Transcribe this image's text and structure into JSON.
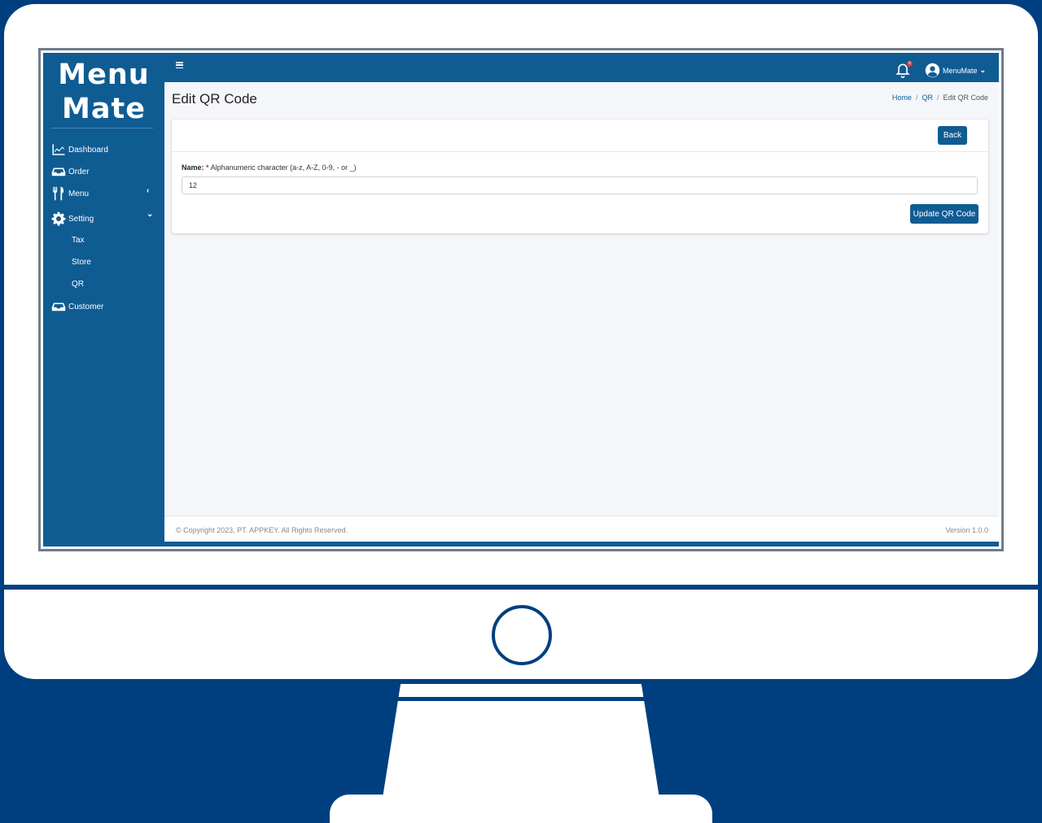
{
  "brand": {
    "line1": "Menu",
    "line2": "Mate"
  },
  "sidebar": {
    "items": [
      {
        "label": "Dashboard",
        "icon": "chart-line-icon"
      },
      {
        "label": "Order",
        "icon": "tray-icon"
      },
      {
        "label": "Menu",
        "icon": "utensils-icon",
        "chevron": "‹"
      },
      {
        "label": "Setting",
        "icon": "gear-icon",
        "chevron": "⌄"
      },
      {
        "label": "Customer",
        "icon": "tray-icon"
      }
    ],
    "sub_items": [
      "Tax",
      "Store",
      "QR"
    ]
  },
  "topbar": {
    "menu_icon": "hamburger-icon",
    "notification_icon": "bell-icon",
    "notification_count": "8",
    "user_name": "MenuMate",
    "user_chevron": "⌄"
  },
  "page": {
    "title": "Edit QR Code",
    "breadcrumb": [
      "Home",
      "QR",
      "Edit QR Code"
    ],
    "breadcrumb_separator": "/"
  },
  "form": {
    "back_label": "Back",
    "name_label": "Name:",
    "required_mark": "*",
    "name_hint": "Alphanumeric character (a-z, A-Z, 0-9, - or _)",
    "name_value": "12",
    "submit_label": "Update QR Code"
  },
  "footer": {
    "copyright": "© Copyright 2023, PT. APPKEY. All Rights Reserved.",
    "version": "Version 1.0.0"
  },
  "colors": {
    "background": "#003f7f",
    "sidebar": "#0f5c93",
    "content": "#f4f6f9",
    "button": "#0f5c93"
  }
}
